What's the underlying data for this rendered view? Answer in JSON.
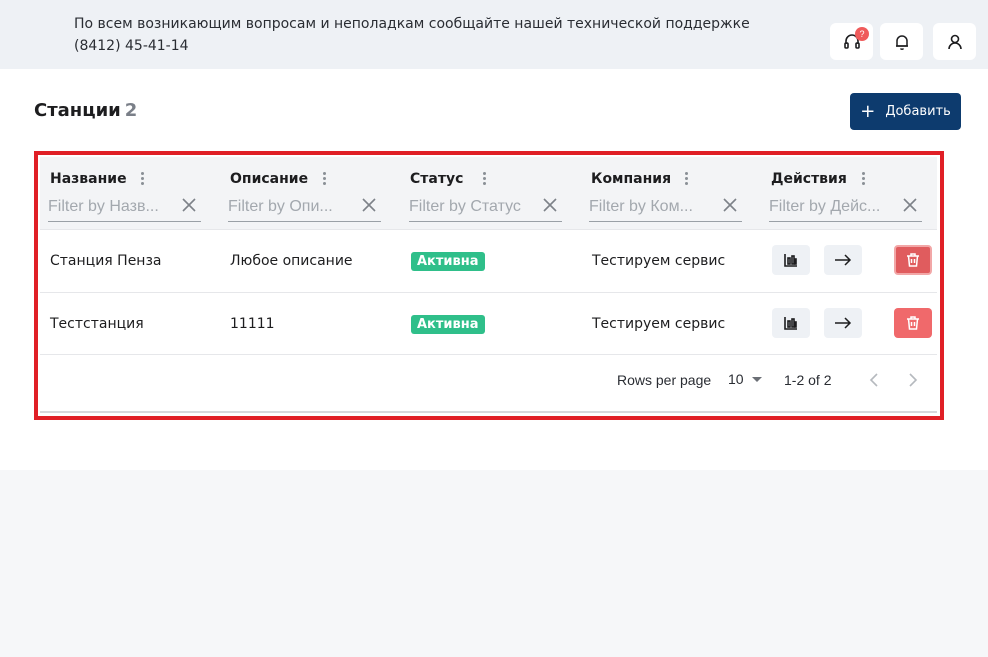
{
  "topbar": {
    "notice": "По всем возникающим вопросам и неполадкам сообщайте нашей технической поддержке (8412) 45-41-14",
    "support_badge": "?"
  },
  "page": {
    "title": "Станции",
    "count": "2",
    "add_label": "Добавить"
  },
  "table": {
    "columns": [
      {
        "label": "Название",
        "placeholder": "Filter by Назв..."
      },
      {
        "label": "Описание",
        "placeholder": "Filter by Опи..."
      },
      {
        "label": "Статус",
        "placeholder": "Filter by Статус"
      },
      {
        "label": "Компания",
        "placeholder": "Filter by Ком..."
      },
      {
        "label": "Действия",
        "placeholder": "Filter by Дейс..."
      }
    ],
    "rows": [
      {
        "name": "Станция Пенза",
        "description": "Любое описание",
        "status": "Активна",
        "company": "Тестируем сервис"
      },
      {
        "name": "Тестстанция",
        "description": "11111",
        "status": "Активна",
        "company": "Тестируем сервис"
      }
    ],
    "footer": {
      "rows_per_page_label": "Rows per page",
      "rows_per_page_value": "10",
      "range": "1-2 of 2"
    }
  },
  "colors": {
    "accent": "#0d3b6e",
    "status_active": "#2fbf8a",
    "delete": "#f0696b",
    "highlight": "#e01f26"
  }
}
